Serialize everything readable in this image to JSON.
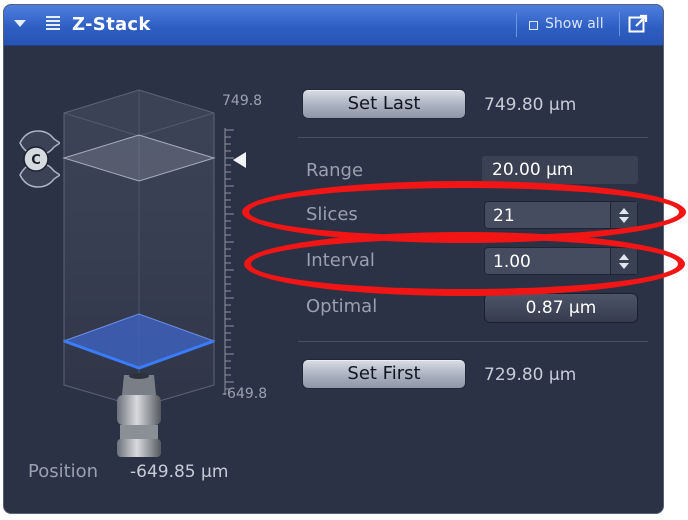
{
  "panel": {
    "title": "Z-Stack",
    "show_all_label": "Show all"
  },
  "stack_view": {
    "scale_top": "749.8",
    "scale_bottom": "-649.8",
    "center_handle_label": "C",
    "position_label": "Position",
    "position_value": "-649.85 µm"
  },
  "controls": {
    "set_last_label": "Set Last",
    "last_value": "749.80 µm",
    "range_label": "Range",
    "range_value": "20.00 µm",
    "slices_label": "Slices",
    "slices_value": "21",
    "interval_label": "Interval",
    "interval_value": "1.00",
    "optimal_label": "Optimal",
    "optimal_value": "0.87 µm",
    "set_first_label": "Set First",
    "first_value": "729.80 µm"
  },
  "colors": {
    "title_bar": "#2f5fc3",
    "panel_background": "#2b3245",
    "annotation_red": "#f21515",
    "first_plane": "#3f66c8"
  }
}
